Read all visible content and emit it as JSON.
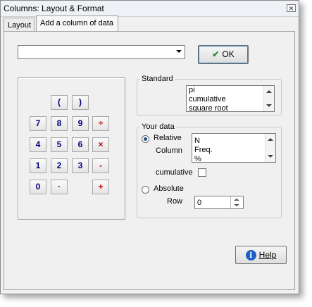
{
  "window": {
    "title": "Columns: Layout & Format",
    "close_glyph": "✕"
  },
  "tabs": [
    {
      "label": "Layout",
      "active": false
    },
    {
      "label": "Add a column of data",
      "active": true
    }
  ],
  "combo": {
    "value": ""
  },
  "ok_button": {
    "label": "OK",
    "icon": "check-icon"
  },
  "keypad": {
    "keys": {
      "lparen": "(",
      "rparen": ")",
      "k7": "7",
      "k8": "8",
      "k9": "9",
      "div": "÷",
      "k4": "4",
      "k5": "5",
      "k6": "6",
      "mul": "×",
      "k1": "1",
      "k2": "2",
      "k3": "3",
      "sub": "-",
      "k0": "0",
      "dot": "·",
      "add": "+"
    }
  },
  "standard": {
    "label": "Standard",
    "items": [
      "pi",
      "cumulative",
      "square root"
    ]
  },
  "your_data": {
    "label": "Your data",
    "relative_label": "Relative",
    "relative_selected": true,
    "column_label": "Column",
    "column_items": [
      "N",
      "Freq.",
      "%"
    ],
    "cumulative_label": "cumulative",
    "cumulative_checked": false,
    "absolute_label": "Absolute",
    "absolute_selected": false,
    "row_label": "Row",
    "row_value": "0"
  },
  "help_button": {
    "label": "Help",
    "icon": "info-icon",
    "icon_glyph": "i"
  },
  "colors": {
    "operator": "#c00000",
    "digit": "#00007a",
    "ok_check": "#2e8b2e",
    "info": "#1d5fc4"
  }
}
